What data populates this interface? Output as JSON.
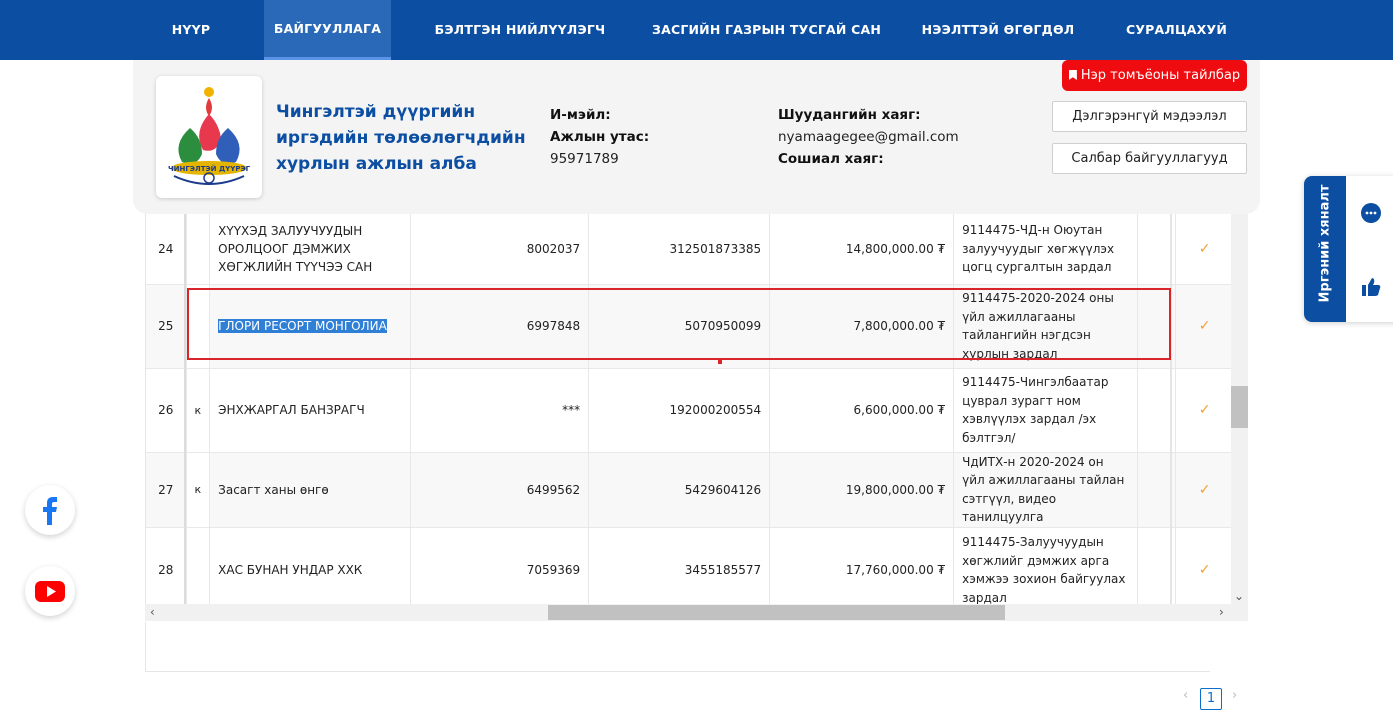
{
  "nav": {
    "items": [
      "НҮҮР",
      "БАЙГУУЛЛАГА",
      "БЭЛТГЭН НИЙЛҮҮЛЭГЧ",
      "ЗАСГИЙН ГАЗРЫН ТУСГАЙ САН",
      "НЭЭЛТТЭЙ ӨГӨГДӨЛ",
      "СУРАЛЦАХУЙ"
    ],
    "active": "БАЙГУУЛЛАГА"
  },
  "org": {
    "logo_text": "ЧИНГЭЛТЭЙ ДҮҮРЭГ",
    "title_lines": [
      "Чингэлтэй дүүргийн",
      "иргэдийн төлөөлөгчдийн",
      "хурлын ажлын алба"
    ],
    "email_label": "И-мэйл:",
    "phone_label": "Ажлын утас:",
    "phone": "95971789",
    "mail_address_label": "Шуудангийн хаяг:",
    "email": "nyamaagegee@gmail.com",
    "social_label": "Сошиал хаяг:",
    "legend_button": "Нэр томъёоны тайлбар",
    "details_button": "Дэлгэрэнгүй мэдээлэл",
    "branches_button": "Салбар байгууллагууд"
  },
  "table": {
    "rows": [
      {
        "idx": "24",
        "prefix": "",
        "name": "ХҮҮХЭД ЗАЛУУЧУУДЫН ОРОЛЦООГ ДЭМЖИХ ХӨГЖЛИЙН ТҮҮЧЭЭ САН",
        "reg": "8002037",
        "account": "312501873385",
        "amount": "14,800,000.00 ₮",
        "desc": "9114475-ЧД-н Оюутан залуучуудыг хөгжүүлэх цогц сургалтын зардал",
        "check": "✓"
      },
      {
        "idx": "25",
        "prefix": "",
        "name": "ГЛОРИ РЕСОРТ МОНГОЛИА",
        "reg": "6997848",
        "account": "5070950099",
        "amount": "7,800,000.00 ₮",
        "desc": "9114475-2020-2024 оны үйл ажиллагааны тайлангийн нэгдсэн хурлын зардал",
        "check": "✓"
      },
      {
        "idx": "26",
        "prefix": "к",
        "name": "ЭНХЖАРГАЛ БАНЗРАГЧ",
        "reg": "***",
        "account": "192000200554",
        "amount": "6,600,000.00 ₮",
        "desc": "9114475-Чингэлбаатар цуврал зурагт ном хэвлүүлэх зардал /эх бэлтгэл/",
        "check": "✓"
      },
      {
        "idx": "27",
        "prefix": "к",
        "name": "Засагт ханы өнгө",
        "reg": "6499562",
        "account": "5429604126",
        "amount": "19,800,000.00 ₮",
        "desc": "ЧдИТХ-н 2020-2024 он үйл ажиллагааны тайлан сэтгүүл, видео танилцуулга",
        "check": "✓"
      },
      {
        "idx": "28",
        "prefix": "",
        "name": "ХАС БУНАН УНДАР ХХК",
        "reg": "7059369",
        "account": "3455185577",
        "amount": "17,760,000.00 ₮",
        "desc": "9114475-Залуучуудын хөгжлийг дэмжих арга хэмжээ зохион байгуулах зардал",
        "check": "✓"
      }
    ]
  },
  "pagination": {
    "prev": "‹",
    "current": "1",
    "next": "›"
  },
  "feedback": {
    "tab_label": "Иргэний хяналт"
  }
}
